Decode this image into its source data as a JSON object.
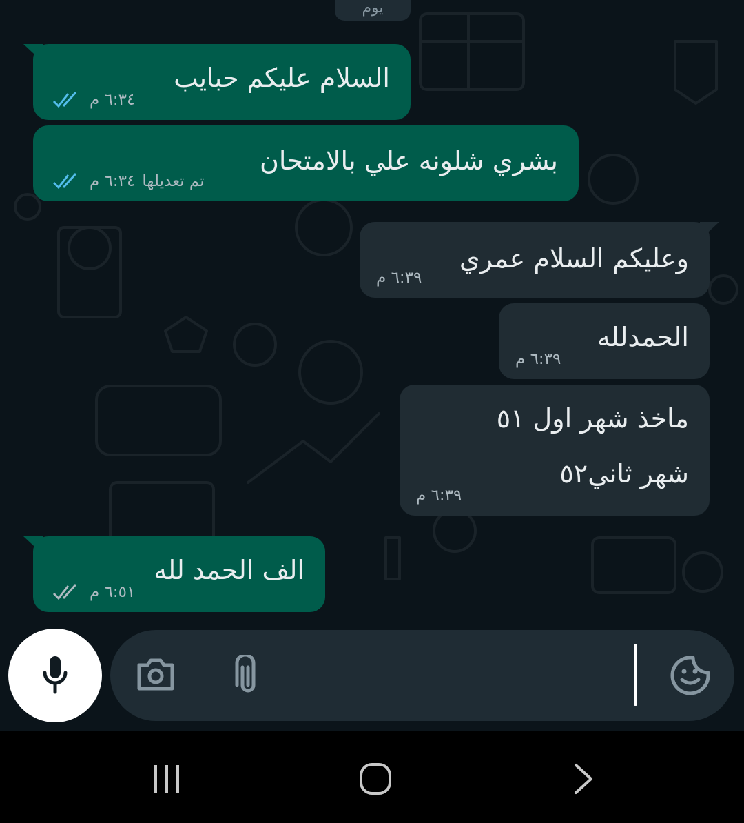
{
  "colors": {
    "background": "#0b141a",
    "outgoing_bubble": "#005c4b",
    "incoming_bubble": "#202c33",
    "read_tick": "#53bdeb",
    "delivered_tick": "#aebac1"
  },
  "date_chip": {
    "label": "يوم"
  },
  "messages": [
    {
      "direction": "outgoing",
      "text": "السلام عليكم حبايب",
      "time": "٦:٣٤ م",
      "status": "read"
    },
    {
      "direction": "outgoing",
      "text": "بشري شلونه علي بالامتحان",
      "time": "٦:٣٤ م",
      "edited_label": "تم تعديلها",
      "status": "read"
    },
    {
      "direction": "incoming",
      "text": "وعليكم السلام عمري",
      "time": "٦:٣٩ م"
    },
    {
      "direction": "incoming",
      "text": "الحمدلله",
      "time": "٦:٣٩ م"
    },
    {
      "direction": "incoming",
      "lines": [
        "ماخذ شهر اول ٥١",
        "شهر ثاني٥٢"
      ],
      "time": "٦:٣٩ م"
    },
    {
      "direction": "outgoing",
      "text": "الف الحمد لله",
      "time": "٦:٥١ م",
      "status": "delivered"
    }
  ],
  "composer": {
    "icons": [
      "emoji-sticker-icon",
      "attach-icon",
      "camera-icon",
      "microphone-icon"
    ]
  },
  "navigation_bar": {
    "icons": [
      "recent-apps-icon",
      "home-icon",
      "back-icon"
    ]
  }
}
